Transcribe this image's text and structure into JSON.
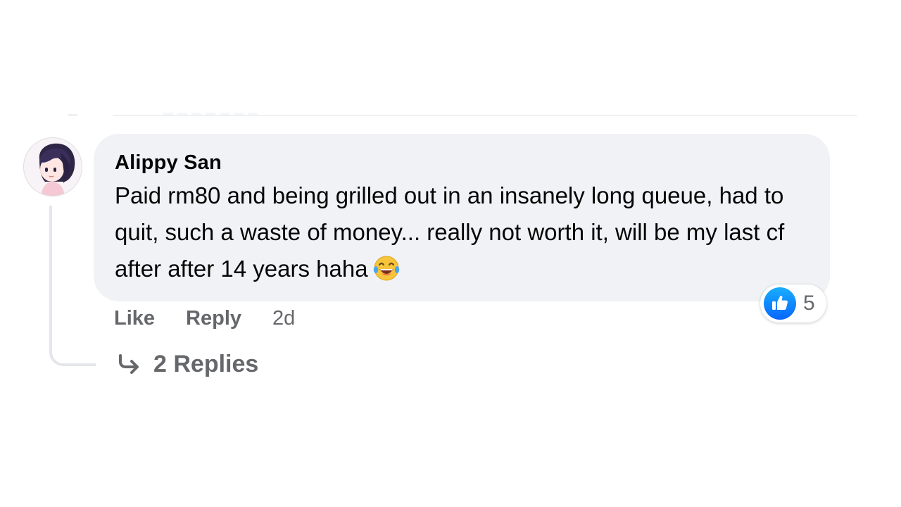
{
  "comment": {
    "author": "Alippy San",
    "text": "Paid rm80 and being grilled out in an insanely long queue, had to quit, such a waste of money... really not worth it, will be my last cf after after 14 years haha",
    "emoji": "laughing-with-tears-emoji",
    "reaction_icon": "thumbs-up-icon",
    "reaction_count": "5",
    "like_label": "Like",
    "reply_label": "Reply",
    "timestamp": "2d",
    "replies_label": "2 Replies",
    "colors": {
      "bubble": "#f0f2f5",
      "secondary_text": "#65676b",
      "like_blue": "#0866ff"
    }
  }
}
